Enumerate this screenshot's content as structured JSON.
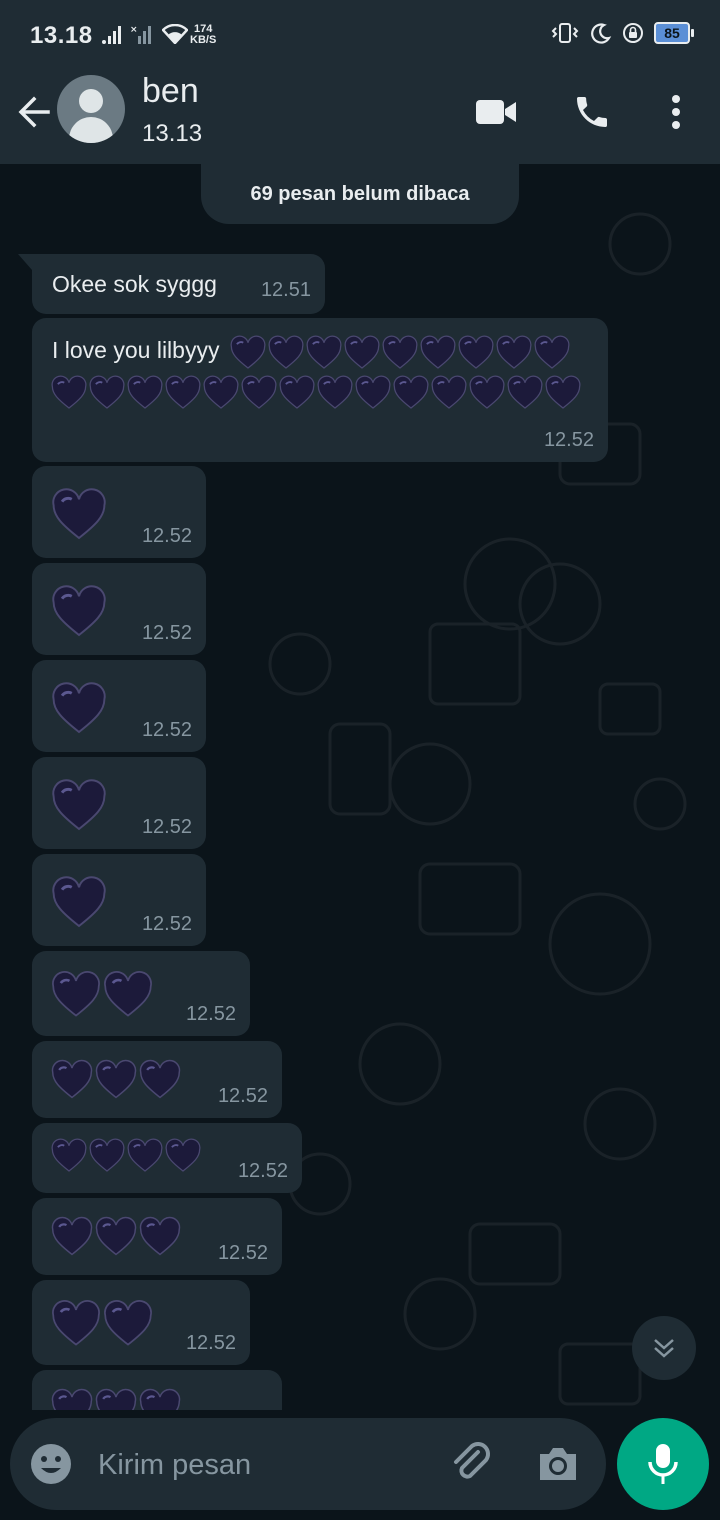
{
  "status_bar": {
    "time": "13.18",
    "net_speed": "174",
    "net_unit": "KB/S",
    "battery": "85"
  },
  "header": {
    "contact_name": "ben",
    "contact_status": "13.13"
  },
  "chat": {
    "unread_banner": "69 pesan belum dibaca",
    "messages": [
      {
        "text": "Okee sok syggg",
        "time": "12.51"
      },
      {
        "text": "I love you lilbyyy",
        "hearts": 23,
        "time": "12.52"
      },
      {
        "hearts": 1,
        "time": "12.52"
      },
      {
        "hearts": 1,
        "time": "12.52"
      },
      {
        "hearts": 1,
        "time": "12.52"
      },
      {
        "hearts": 1,
        "time": "12.52"
      },
      {
        "hearts": 1,
        "time": "12.52"
      },
      {
        "hearts": 2,
        "time": "12.52"
      },
      {
        "hearts": 3,
        "time": "12.52"
      },
      {
        "hearts": 4,
        "time": "12.52"
      },
      {
        "hearts": 3,
        "time": "12.52"
      },
      {
        "hearts": 2,
        "time": "12.52"
      },
      {
        "hearts": 3,
        "time": ""
      }
    ]
  },
  "input": {
    "placeholder": "Kirim pesan"
  },
  "colors": {
    "header_bg": "#1f2c34",
    "chat_bg": "#0b141a",
    "bubble_bg": "#1f2c34",
    "accent_green": "#00a884",
    "heart": "#1c1a3a"
  },
  "icons": {
    "back": "arrow-left-icon",
    "video": "video-camera-icon",
    "call": "phone-icon",
    "menu": "more-vertical-icon",
    "emoji": "emoji-icon",
    "attach": "paperclip-icon",
    "camera": "camera-icon",
    "mic": "microphone-icon",
    "scroll": "double-chevron-down-icon"
  }
}
